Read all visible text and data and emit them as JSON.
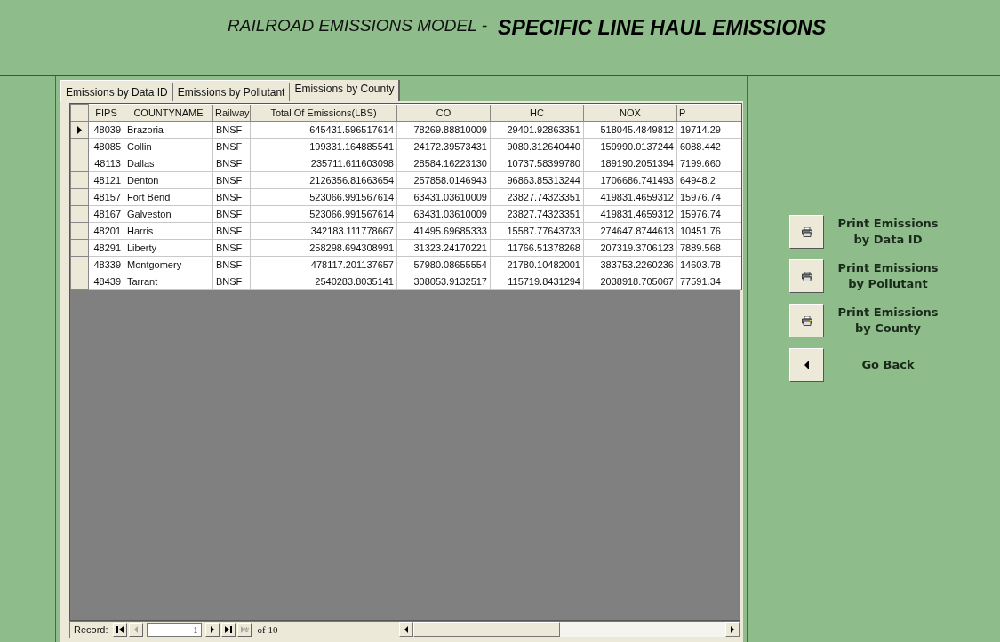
{
  "header": {
    "subtitle": "RAILROAD EMISSIONS MODEL -",
    "title": "SPECIFIC LINE HAUL EMISSIONS"
  },
  "tabs": [
    {
      "label": "Emissions by Data ID",
      "selected": false
    },
    {
      "label": "Emissions by Pollutant",
      "selected": false
    },
    {
      "label": "Emissions by County",
      "selected": true
    }
  ],
  "table": {
    "columns": [
      "FIPS",
      "COUNTYNAME",
      "Railway",
      "Total Of Emissions(LBS)",
      "CO",
      "HC",
      "NOX",
      "P"
    ],
    "rows": [
      {
        "selected": true,
        "cells": [
          "48039",
          "Brazoria",
          "BNSF",
          "645431.596517614",
          "78269.88810009",
          "29401.92863351",
          "518045.4849812",
          "19714.29"
        ]
      },
      {
        "selected": false,
        "cells": [
          "48085",
          "Collin",
          "BNSF",
          "199331.164885541",
          "24172.39573431",
          "9080.312640440",
          "159990.0137244",
          "6088.442"
        ]
      },
      {
        "selected": false,
        "cells": [
          "48113",
          "Dallas",
          "BNSF",
          "235711.611603098",
          "28584.16223130",
          "10737.58399780",
          "189190.2051394",
          "7199.660"
        ]
      },
      {
        "selected": false,
        "cells": [
          "48121",
          "Denton",
          "BNSF",
          "2126356.81663654",
          "257858.0146943",
          "96863.85313244",
          "1706686.741493",
          "64948.2"
        ]
      },
      {
        "selected": false,
        "cells": [
          "48157",
          "Fort Bend",
          "BNSF",
          "523066.991567614",
          "63431.03610009",
          "23827.74323351",
          "419831.4659312",
          "15976.74"
        ]
      },
      {
        "selected": false,
        "cells": [
          "48167",
          "Galveston",
          "BNSF",
          "523066.991567614",
          "63431.03610009",
          "23827.74323351",
          "419831.4659312",
          "15976.74"
        ]
      },
      {
        "selected": false,
        "cells": [
          "48201",
          "Harris",
          "BNSF",
          "342183.111778667",
          "41495.69685333",
          "15587.77643733",
          "274647.8744613",
          "10451.76"
        ]
      },
      {
        "selected": false,
        "cells": [
          "48291",
          "Liberty",
          "BNSF",
          "258298.694308991",
          "31323.24170221",
          "11766.51378268",
          "207319.3706123",
          "7889.568"
        ]
      },
      {
        "selected": false,
        "cells": [
          "48339",
          "Montgomery",
          "BNSF",
          "478117.201137657",
          "57980.08655554",
          "21780.10482001",
          "383753.2260236",
          "14603.78"
        ]
      },
      {
        "selected": false,
        "cells": [
          "48439",
          "Tarrant",
          "BNSF",
          "2540283.8035141",
          "308053.9132517",
          "115719.8431294",
          "2038918.705067",
          "77591.34"
        ]
      }
    ]
  },
  "navigator": {
    "label": "Record:",
    "current": "1",
    "of": "of 10",
    "buttons": [
      {
        "kind": "first",
        "disabled": false
      },
      {
        "kind": "prev",
        "disabled": true
      },
      {
        "kind": "next",
        "disabled": false
      },
      {
        "kind": "last",
        "disabled": false
      },
      {
        "kind": "new",
        "disabled": true
      }
    ]
  },
  "actions": [
    {
      "kind": "print",
      "label": "Print Emissions\nby Data ID"
    },
    {
      "kind": "print",
      "label": "Print Emissions\nby Pollutant"
    },
    {
      "kind": "print",
      "label": "Print Emissions\nby County"
    },
    {
      "kind": "back",
      "label": "Go Back"
    }
  ]
}
